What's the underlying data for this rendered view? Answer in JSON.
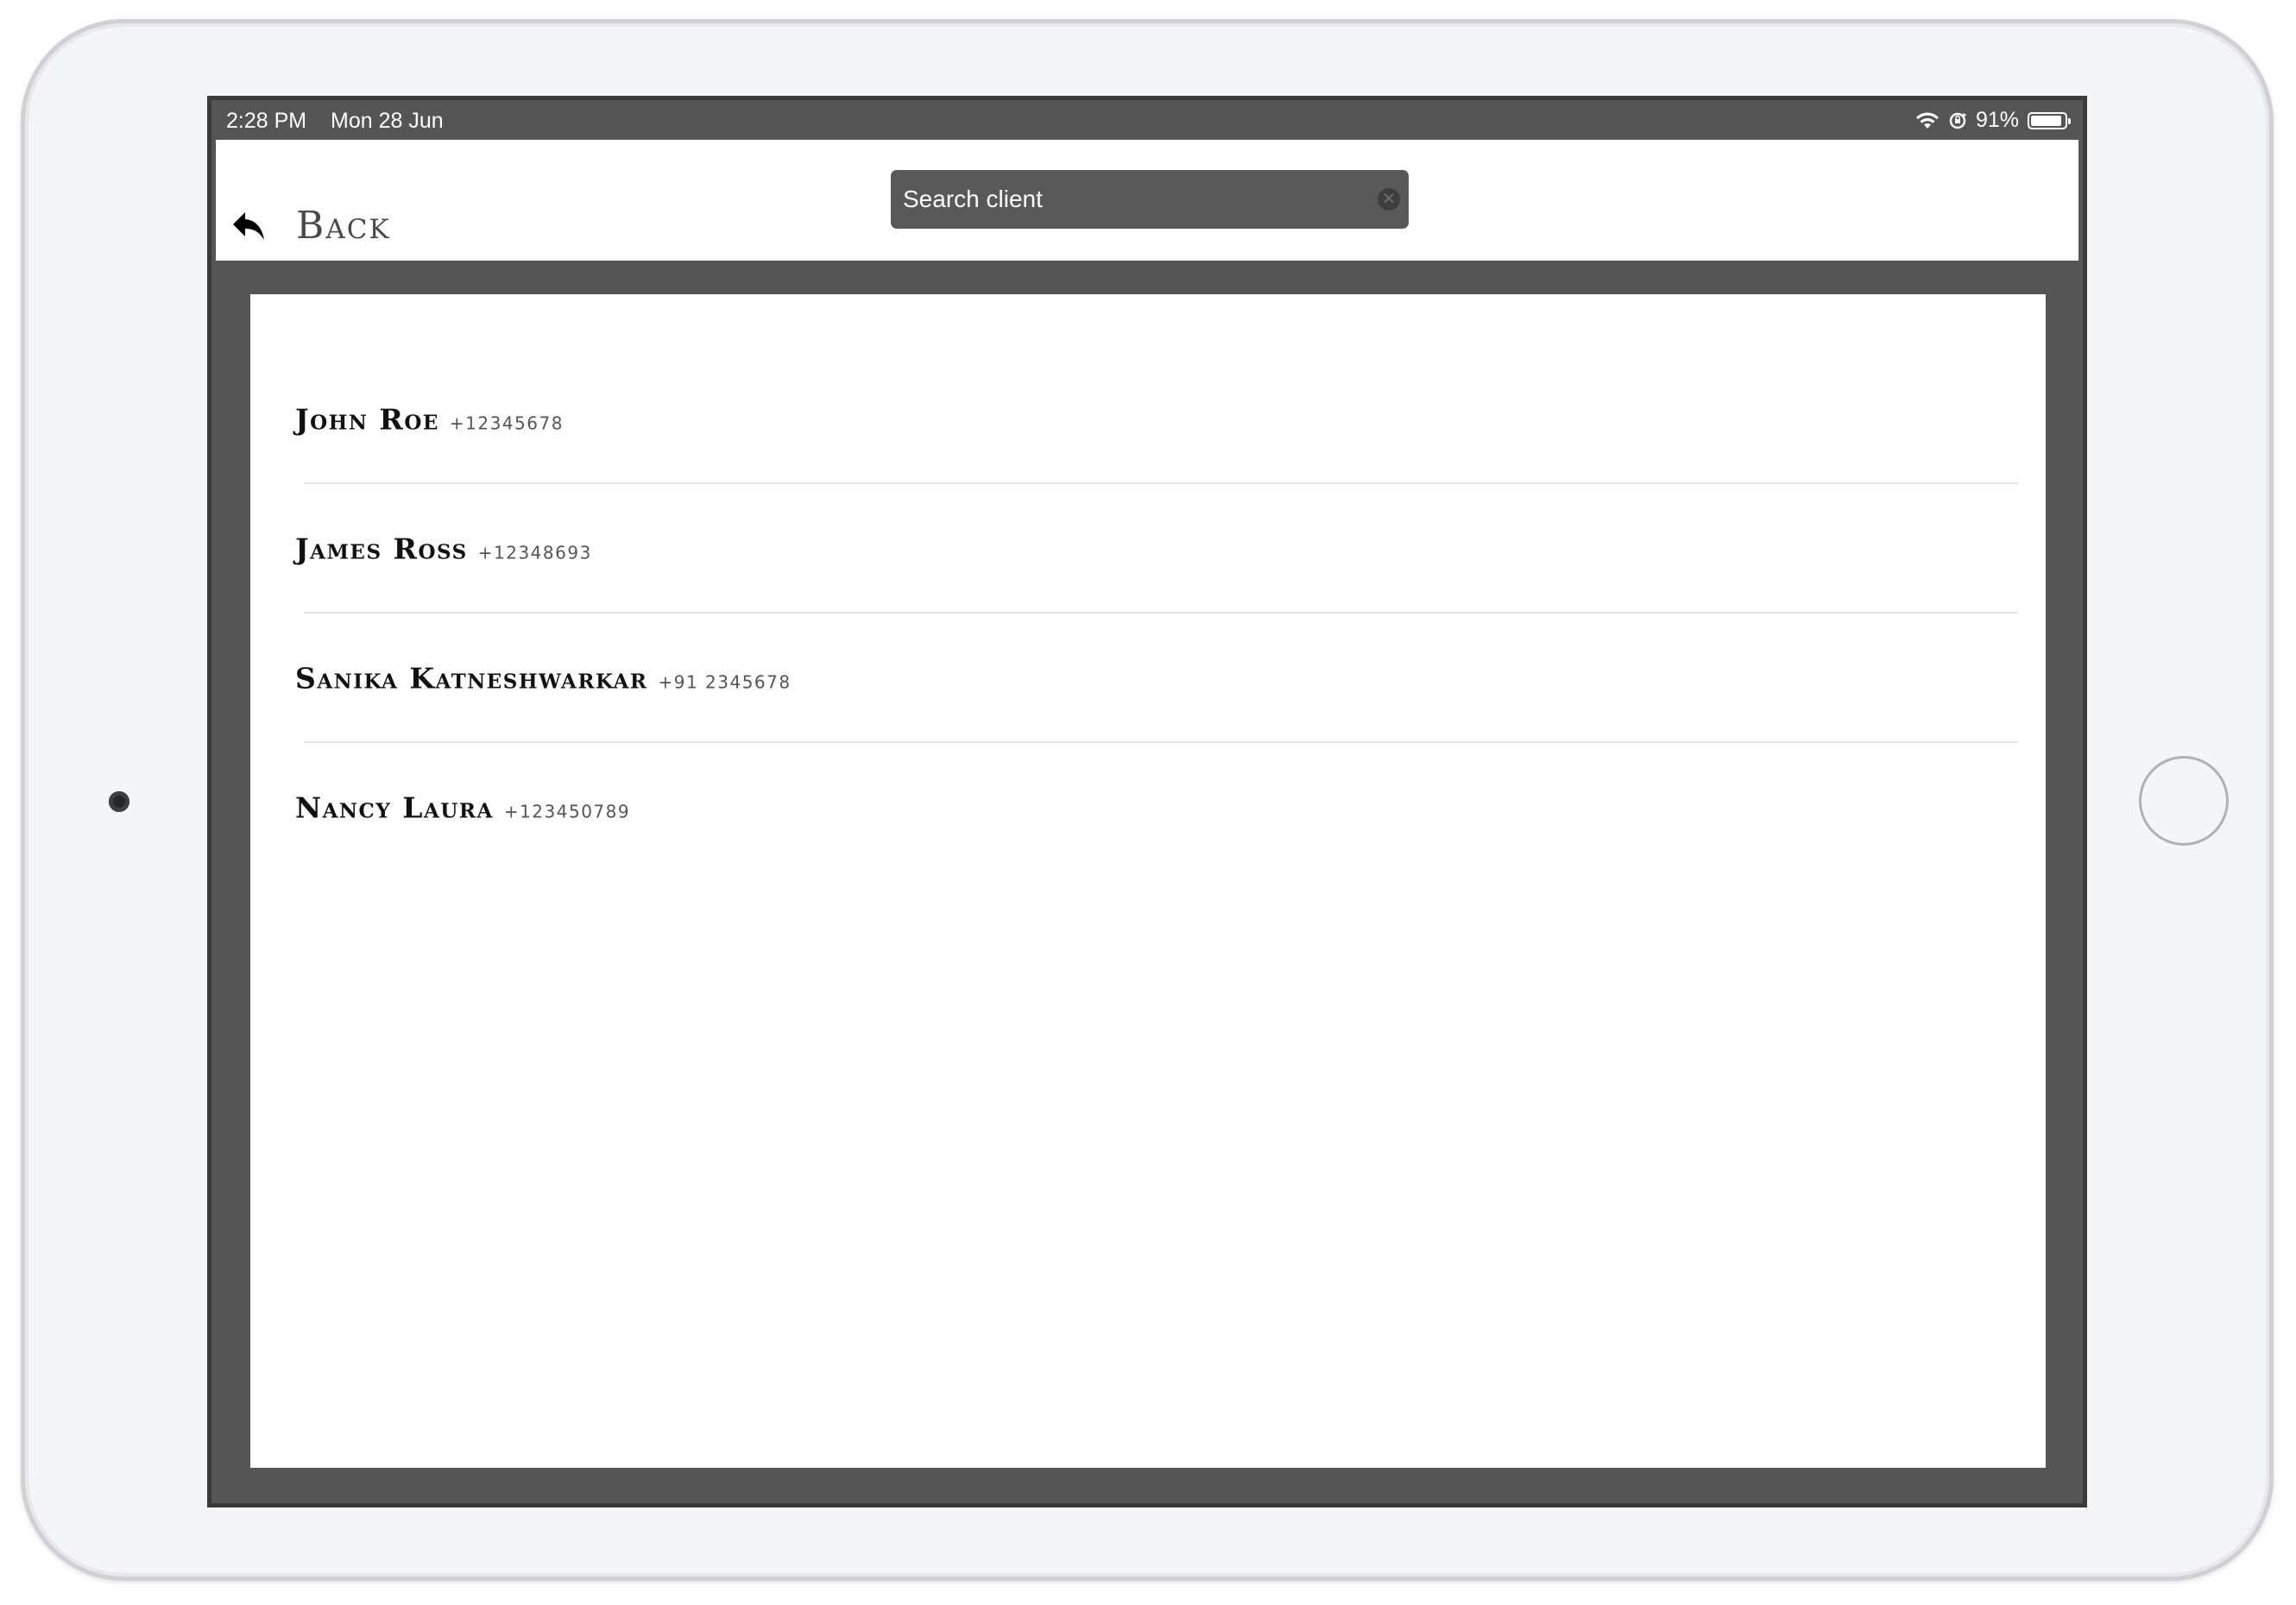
{
  "status_bar": {
    "time": "2:28 PM",
    "date": "Mon 28 Jun",
    "battery_text": "91%",
    "battery_level": 0.91
  },
  "nav": {
    "back_label": "Back",
    "search_placeholder": "Search client"
  },
  "clients": [
    {
      "name": "John Roe",
      "phone": "+12345678"
    },
    {
      "name": "James Ross",
      "phone": "+12348693"
    },
    {
      "name": "Sanika Katneshwarkar",
      "phone": "+91 2345678"
    },
    {
      "name": "Nancy Laura",
      "phone": "+123450789"
    }
  ],
  "colors": {
    "frame": "#555555",
    "panel": "#ffffff",
    "search_bg": "#595959"
  }
}
